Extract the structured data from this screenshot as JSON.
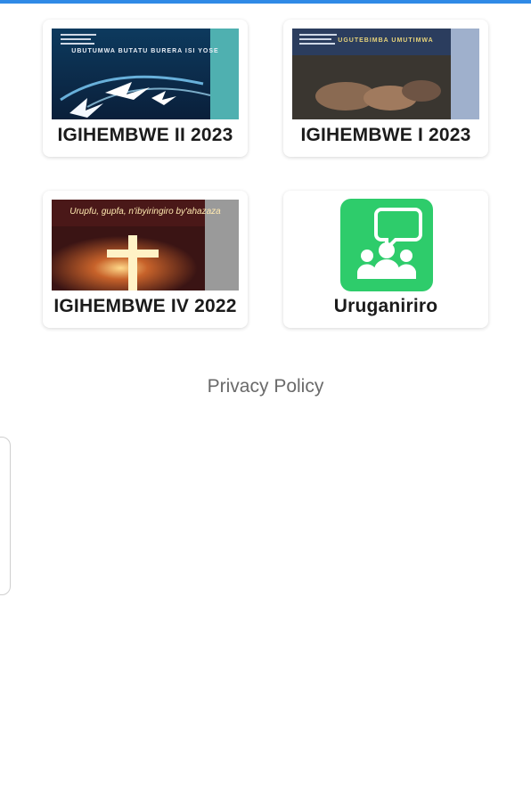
{
  "cards": [
    {
      "label": "IGIHEMBWE II 2023",
      "cover_title": "UBUTUMWA BUTATU BURERA ISI YOSE"
    },
    {
      "label": "IGIHEMBWE I 2023",
      "cover_title": "UGUTEBIMBA UMUTIMWA"
    },
    {
      "label": "IGIHEMBWE IV 2022",
      "cover_title": "Urupfu, gupfa, n'ibyiringiro by'ahazaza"
    },
    {
      "label": "Uruganiriro"
    }
  ],
  "footer": {
    "privacy_label": "Privacy Policy"
  },
  "colors": {
    "accent_bar": "#2f8ae6",
    "forum_icon_bg": "#2ecc6b"
  }
}
